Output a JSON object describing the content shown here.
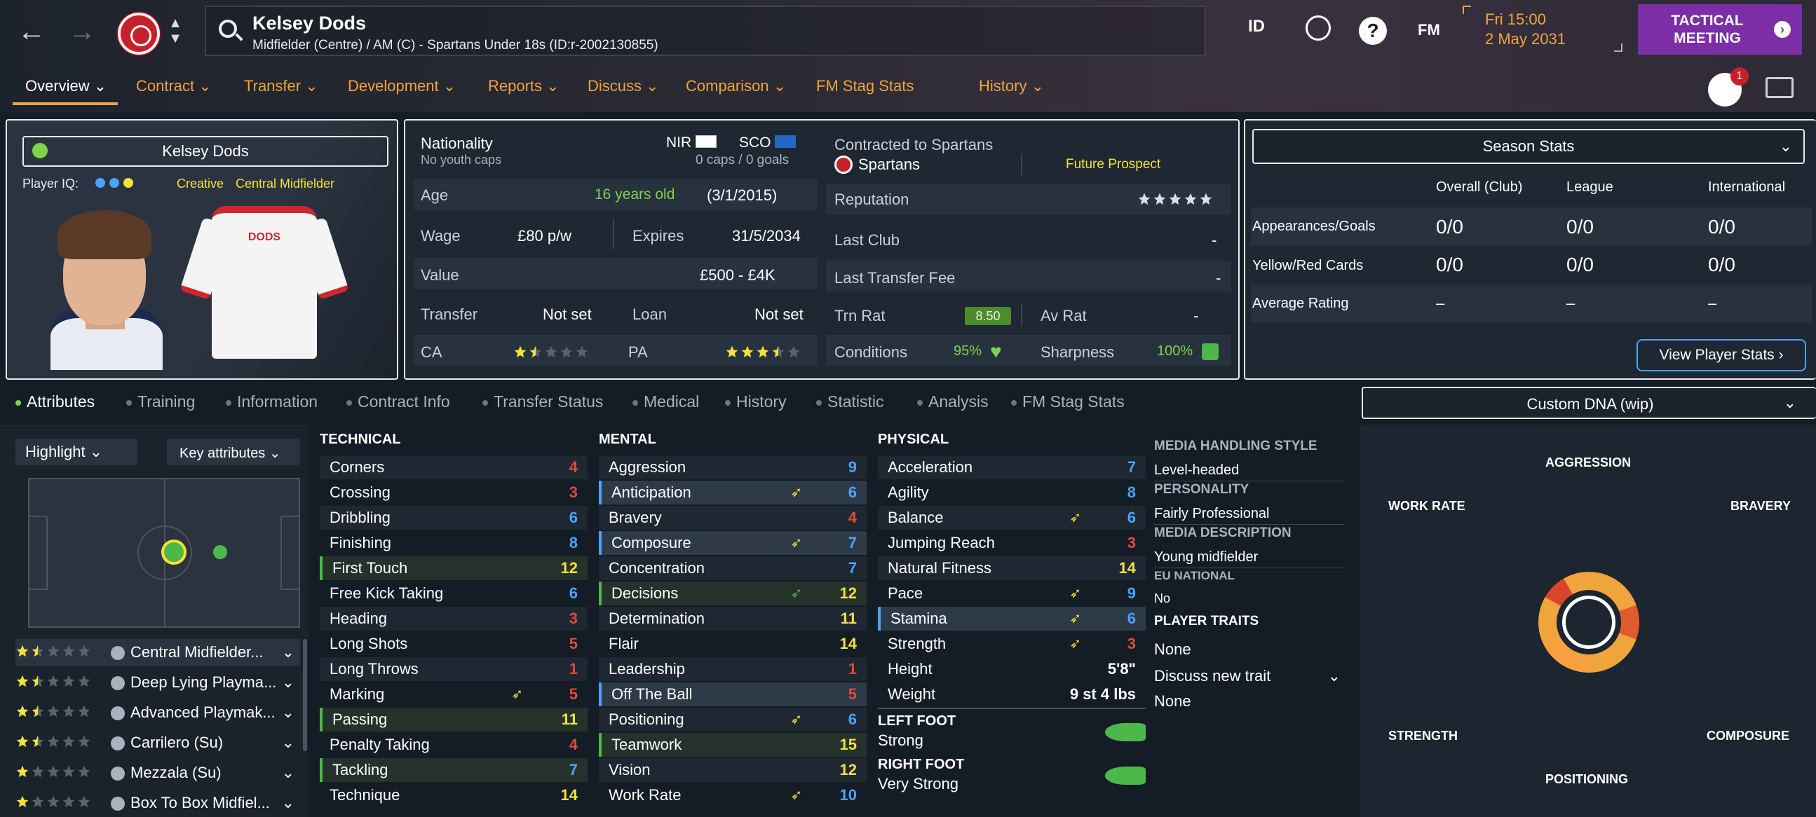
{
  "player": {
    "name": "Kelsey Dods",
    "subtitle": "Midfielder (Centre) / AM (C) - Spartans Under 18s (ID:r-2002130855)",
    "card_name": "Kelsey Dods",
    "iq_label": "Player IQ:",
    "role_tag1": "Creative",
    "role_tag2": "Central Midfielder",
    "shirt_text": "DODS"
  },
  "header": {
    "id_label": "ID",
    "fm_label": "FM",
    "help": "?",
    "time": "Fri 15:00",
    "date": "2 May 2031",
    "tactical": "TACTICAL MEETING",
    "badge": "1"
  },
  "menu": [
    "Overview",
    "Contract",
    "Transfer",
    "Development",
    "Reports",
    "Discuss",
    "Comparison",
    "FM Stag Stats",
    "History"
  ],
  "info": {
    "nationality_label": "Nationality",
    "youth_caps": "No youth caps",
    "nat1": "NIR",
    "nat2": "SCO",
    "caps": "0 caps / 0 goals",
    "age_label": "Age",
    "age": "16 years old",
    "dob": "(3/1/2015)",
    "wage_label": "Wage",
    "wage": "£80 p/w",
    "expires_label": "Expires",
    "expires": "31/5/2034",
    "value_label": "Value",
    "value": "£500 - £4K",
    "transfer_label": "Transfer",
    "transfer": "Not set",
    "loan_label": "Loan",
    "loan": "Not set",
    "ca_label": "CA",
    "pa_label": "PA",
    "ca_stars": 1.5,
    "pa_stars": 3.5
  },
  "club": {
    "contracted": "Contracted to Spartans",
    "club": "Spartans",
    "status": "Future Prospect",
    "rep_label": "Reputation",
    "rep_stars": 0,
    "last_club_label": "Last Club",
    "last_club": "-",
    "last_fee_label": "Last Transfer Fee",
    "last_fee": "-",
    "trn_label": "Trn Rat",
    "trn": "8.50",
    "av_label": "Av Rat",
    "av": "-",
    "cond_label": "Conditions",
    "cond": "95%",
    "sharp_label": "Sharpness",
    "sharp": "100%"
  },
  "season": {
    "title": "Season Stats",
    "cols": [
      "Overall (Club)",
      "League",
      "International"
    ],
    "rows": [
      {
        "label": "Appearances/Goals",
        "vals": [
          "0/0",
          "0/0",
          "0/0"
        ]
      },
      {
        "label": "Yellow/Red Cards",
        "vals": [
          "0/0",
          "0/0",
          "0/0"
        ]
      },
      {
        "label": "Average Rating",
        "vals": [
          "–",
          "–",
          "–"
        ]
      }
    ],
    "button": "View Player Stats ›"
  },
  "tabs": [
    "Attributes",
    "Training",
    "Information",
    "Contract Info",
    "Transfer Status",
    "Medical",
    "History",
    "Statistic",
    "Analysis",
    "FM Stag Stats"
  ],
  "dna": {
    "title": "Custom DNA (wip)",
    "labels": [
      "AGGRESSION",
      "WORK RATE",
      "BRAVERY",
      "STRENGTH",
      "COMPOSURE",
      "POSITIONING"
    ]
  },
  "left": {
    "highlight": "Highlight",
    "key": "Key attributes",
    "roles": [
      {
        "name": "Central Midfielder...",
        "stars": 1.5
      },
      {
        "name": "Deep Lying Playma...",
        "stars": 1.5
      },
      {
        "name": "Advanced Playmak...",
        "stars": 1.5
      },
      {
        "name": "Carrilero (Su)",
        "stars": 1.5
      },
      {
        "name": "Mezzala (Su)",
        "stars": 1
      },
      {
        "name": "Box To Box Midfiel...",
        "stars": 1
      }
    ]
  },
  "technical": {
    "title": "TECHNICAL",
    "items": [
      [
        "Corners",
        "4"
      ],
      [
        "Crossing",
        "3"
      ],
      [
        "Dribbling",
        "6"
      ],
      [
        "Finishing",
        "8"
      ],
      [
        "First Touch",
        "12"
      ],
      [
        "Free Kick Taking",
        "6"
      ],
      [
        "Heading",
        "3"
      ],
      [
        "Long Shots",
        "5"
      ],
      [
        "Long Throws",
        "1"
      ],
      [
        "Marking",
        "5"
      ],
      [
        "Passing",
        "11"
      ],
      [
        "Penalty Taking",
        "4"
      ],
      [
        "Tackling",
        "7"
      ],
      [
        "Technique",
        "14"
      ]
    ]
  },
  "mental": {
    "title": "MENTAL",
    "items": [
      [
        "Aggression",
        "9"
      ],
      [
        "Anticipation",
        "6"
      ],
      [
        "Bravery",
        "4"
      ],
      [
        "Composure",
        "7"
      ],
      [
        "Concentration",
        "7"
      ],
      [
        "Decisions",
        "12"
      ],
      [
        "Determination",
        "11"
      ],
      [
        "Flair",
        "14"
      ],
      [
        "Leadership",
        "1"
      ],
      [
        "Off The Ball",
        "5"
      ],
      [
        "Positioning",
        "6"
      ],
      [
        "Teamwork",
        "15"
      ],
      [
        "Vision",
        "12"
      ],
      [
        "Work Rate",
        "10"
      ]
    ]
  },
  "physical": {
    "title": "PHYSICAL",
    "items": [
      [
        "Acceleration",
        "7"
      ],
      [
        "Agility",
        "8"
      ],
      [
        "Balance",
        "6"
      ],
      [
        "Jumping Reach",
        "3"
      ],
      [
        "Natural Fitness",
        "14"
      ],
      [
        "Pace",
        "9"
      ],
      [
        "Stamina",
        "6"
      ],
      [
        "Strength",
        "3"
      ]
    ],
    "height_label": "Height",
    "height": "5'8\"",
    "weight_label": "Weight",
    "weight": "9 st 4 lbs",
    "lf_label": "LEFT FOOT",
    "lf": "Strong",
    "rf_label": "RIGHT FOOT",
    "rf": "Very Strong"
  },
  "side": {
    "mhs_label": "MEDIA HANDLING STYLE",
    "mhs": "Level-headed",
    "pers_label": "PERSONALITY",
    "pers": "Fairly Professional",
    "md_label": "MEDIA DESCRIPTION",
    "md": "Young midfielder",
    "eu_label": "EU NATIONAL",
    "eu": "No",
    "traits_label": "PLAYER TRAITS",
    "traits": "None",
    "discuss": "Discuss new trait",
    "traits2": "None"
  },
  "colors": {
    "accent": "#f0a43c",
    "purple": "#7b2ea6",
    "green": "#7fd44a",
    "yellow": "#f2e23a",
    "orange": "#f07a3a",
    "red": "#e04a3a",
    "blue": "#4aa3ff"
  }
}
